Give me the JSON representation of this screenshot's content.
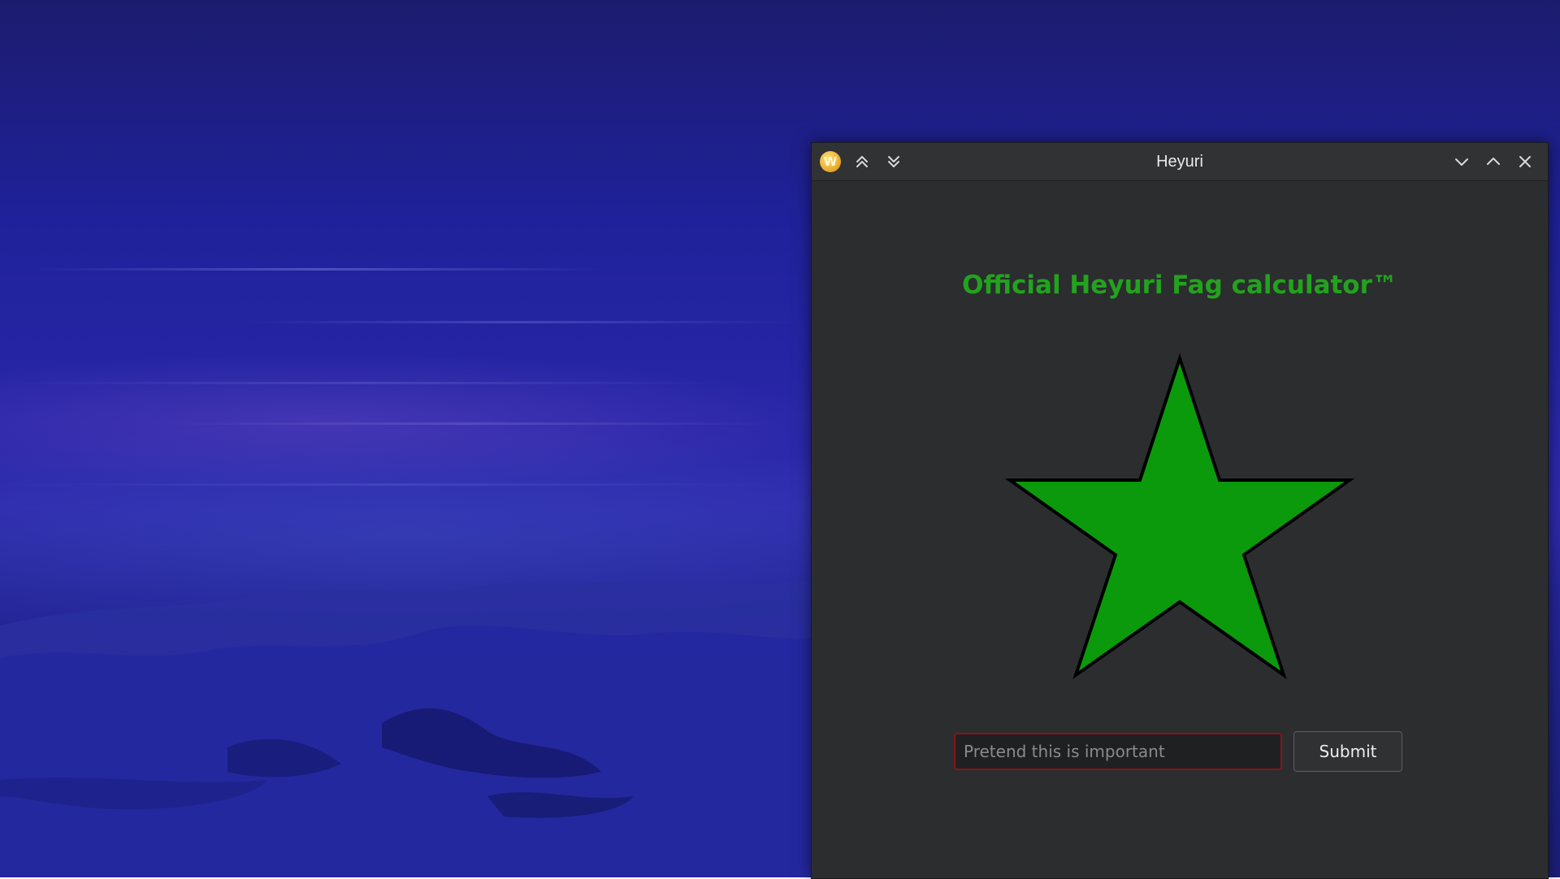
{
  "window": {
    "title": "Heyuri",
    "app_icon": {
      "icon": "app-logo-icon",
      "glyph": "W"
    },
    "titlebar_left_buttons": [
      {
        "icon": "keep-above-icon"
      },
      {
        "icon": "keep-below-icon"
      }
    ],
    "titlebar_right_buttons": [
      {
        "icon": "minimize-icon"
      },
      {
        "icon": "maximize-icon"
      },
      {
        "icon": "close-icon"
      }
    ]
  },
  "app": {
    "headline": "Official Heyuri Fag calculator™",
    "headline_color": "#23a21e",
    "star": {
      "fill": "#0b9a0b",
      "stroke": "#000000",
      "icon": "star-icon"
    },
    "input": {
      "value": "",
      "placeholder": "Pretend this is important",
      "border_color": "#8a1419"
    },
    "submit_label": "Submit"
  },
  "desktop": {
    "wallpaper": "blue snowy landscape"
  }
}
